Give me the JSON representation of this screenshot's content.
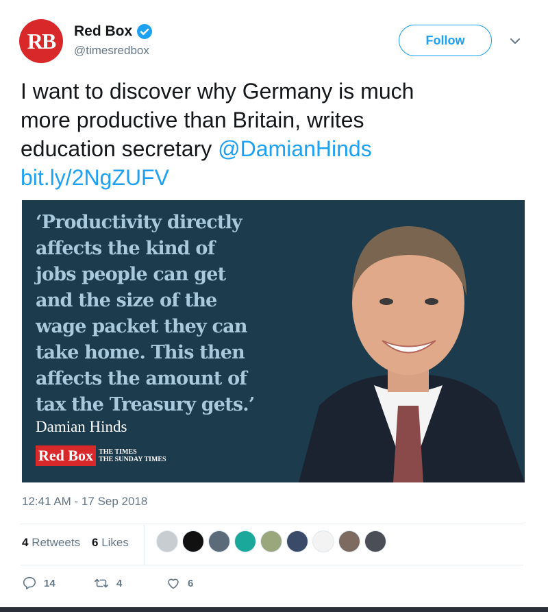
{
  "account": {
    "avatar_text": "RB",
    "display_name": "Red Box",
    "handle": "@timesredbox",
    "follow_label": "Follow"
  },
  "tweet": {
    "text_line1": "I want to discover why Germany is much",
    "text_line2": "more productive than Britain, writes",
    "text_line3": "education secretary ",
    "mention": "@DamianHinds",
    "link": "bit.ly/2NgZUFV"
  },
  "media": {
    "quote_lines": [
      "‘Productivity directly",
      "affects the kind of",
      "jobs people can get",
      "and the size of the",
      "wage packet they can",
      "take home. This then",
      "affects the amount of",
      "tax the Treasury gets.’"
    ],
    "attribution": "Damian Hinds",
    "brand_logo": "Red Box",
    "brand_paper1": "THE TIMES",
    "brand_paper2": "THE SUNDAY TIMES"
  },
  "timestamp": "12:41 AM - 17 Sep 2018",
  "stats": {
    "retweets_count": "4",
    "retweets_label": "Retweets",
    "likes_count": "6",
    "likes_label": "Likes"
  },
  "actions": {
    "replies": "14",
    "retweets": "4",
    "likes": "6"
  },
  "colors": {
    "accent": "#1da1f2",
    "brand_red": "#d8282a",
    "media_bg": "#1c3b4d"
  },
  "icons": [
    "verified-badge-icon",
    "chevron-down-icon",
    "reply-icon",
    "retweet-icon",
    "heart-icon"
  ]
}
